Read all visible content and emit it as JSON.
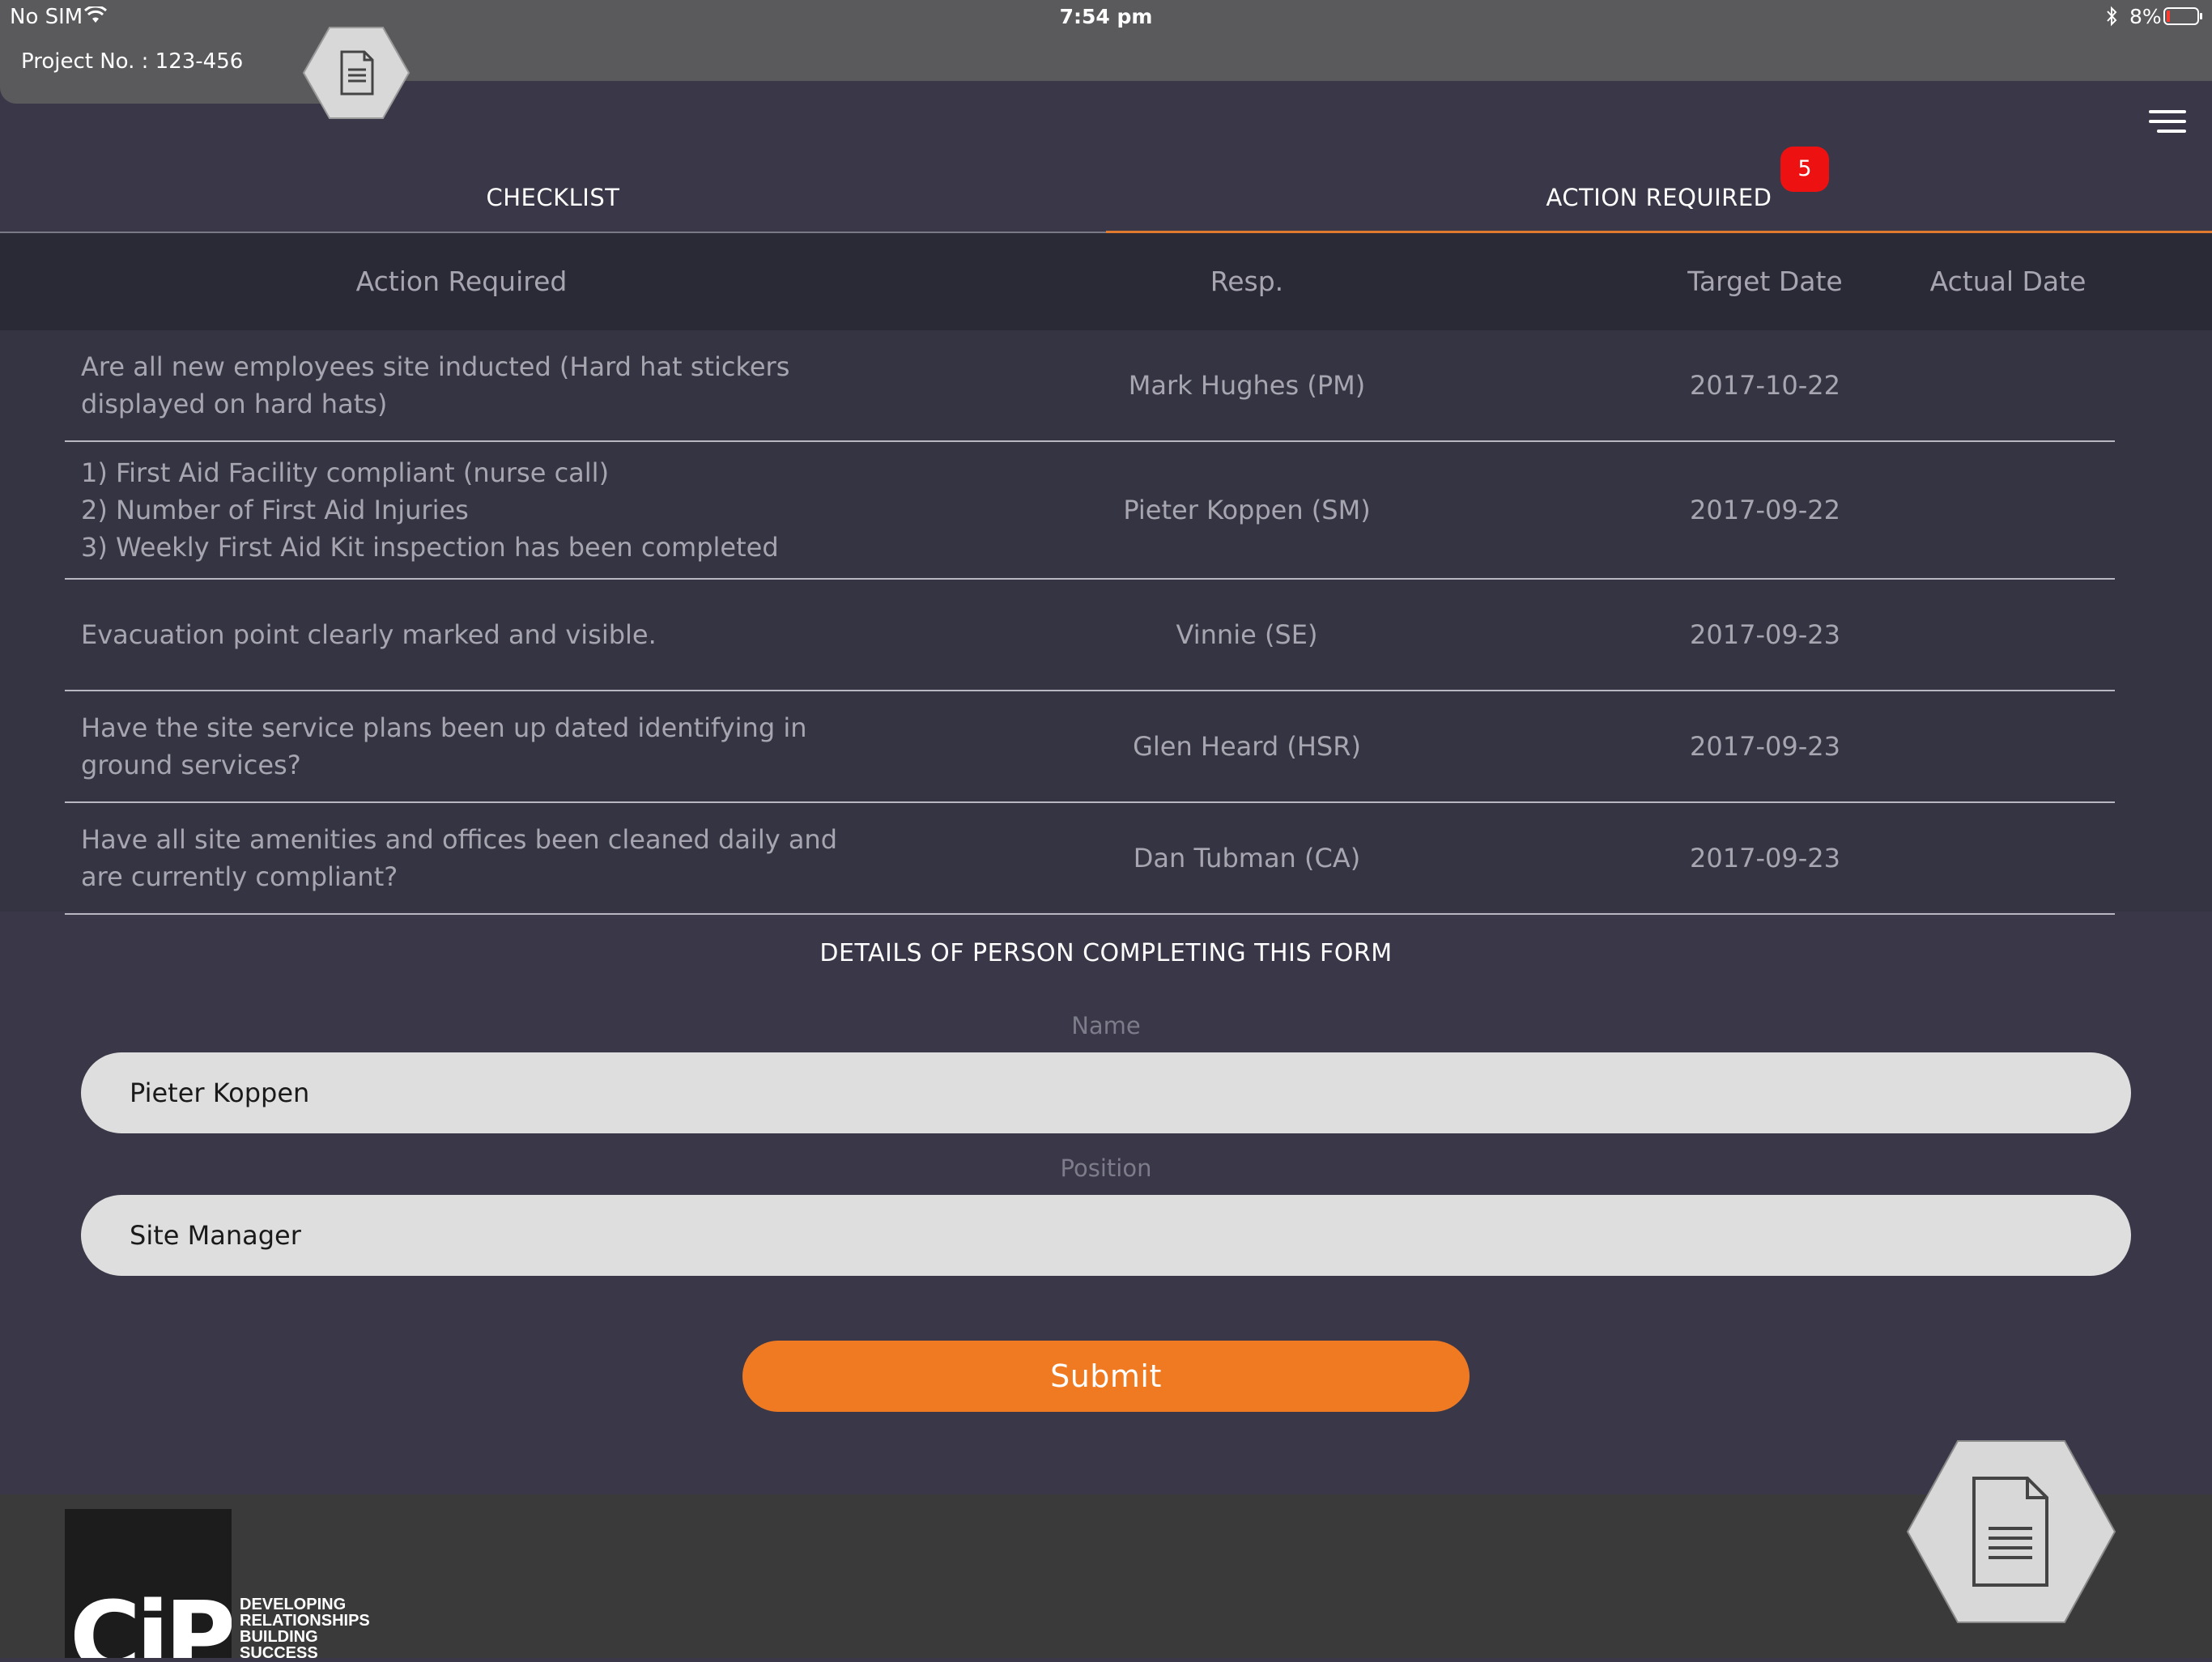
{
  "status_bar": {
    "carrier": "No SIM",
    "time": "7:54 pm",
    "battery": "8%"
  },
  "header": {
    "project_label": "Project No. : 123-456"
  },
  "tabs": [
    {
      "label": "CHECKLIST",
      "active": false
    },
    {
      "label": "ACTION REQUIRED",
      "active": true,
      "badge": "5"
    }
  ],
  "table": {
    "headers": {
      "action": "Action Required",
      "resp": "Resp.",
      "target": "Target Date",
      "actual": "Actual Date"
    },
    "rows": [
      {
        "action_lines": [
          "Are all new employees site inducted (Hard hat stickers",
          "displayed on hard hats)"
        ],
        "resp": "Mark Hughes (PM)",
        "target": "2017-10-22",
        "actual": ""
      },
      {
        "action_lines": [
          "1) First Aid Facility compliant (nurse call)",
          "2) Number of First Aid Injuries",
          "3) Weekly First Aid Kit inspection has been completed"
        ],
        "resp": "Pieter Koppen (SM)",
        "target": "2017-09-22",
        "actual": ""
      },
      {
        "action_lines": [
          "Evacuation point clearly marked and visible."
        ],
        "resp": "Vinnie (SE)",
        "target": "2017-09-23",
        "actual": ""
      },
      {
        "action_lines": [
          "Have the site service plans been up dated identifying in",
          "ground services?"
        ],
        "resp": "Glen Heard (HSR)",
        "target": "2017-09-23",
        "actual": ""
      },
      {
        "action_lines": [
          "Have all site amenities and offices been cleaned daily and",
          "are currently compliant?"
        ],
        "resp": "Dan Tubman (CA)",
        "target": "2017-09-23",
        "actual": ""
      }
    ]
  },
  "form": {
    "title": "DETAILS OF PERSON COMPLETING THIS FORM",
    "name_label": "Name",
    "name_value": "Pieter Koppen",
    "position_label": "Position",
    "position_value": "Site Manager",
    "submit_label": "Submit"
  },
  "footer": {
    "logo_text": "CiP",
    "tagline": [
      "DEVELOPING",
      "RELATIONSHIPS",
      "BUILDING",
      "SUCCESS"
    ]
  },
  "colors": {
    "accent": "#f07a22",
    "badge": "#ee1111",
    "background": "#3a3848",
    "table_header": "#2a2936"
  },
  "icons": {
    "wifi": "wifi-icon",
    "bluetooth": "bluetooth-icon",
    "battery": "battery-icon",
    "document": "document-icon",
    "menu": "menu-icon"
  }
}
